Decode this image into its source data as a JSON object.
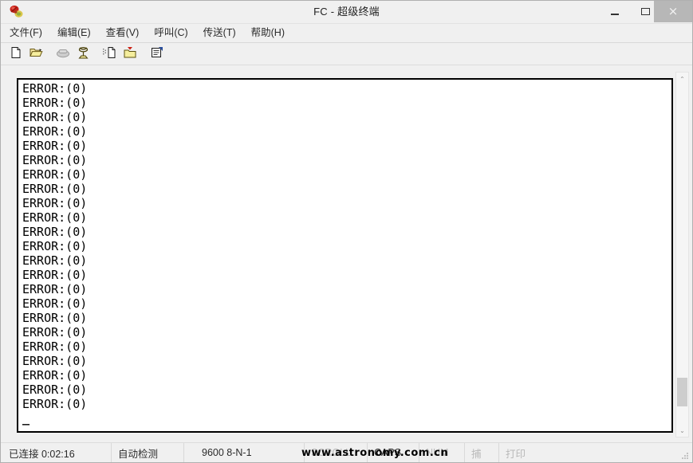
{
  "window": {
    "title": "FC - 超级终端",
    "app_icon": "hyperterminal-icon",
    "controls": {
      "minimize": "–",
      "maximize": "□",
      "close": "×"
    }
  },
  "menubar": {
    "items": [
      {
        "label": "文件(F)",
        "name": "menu-file"
      },
      {
        "label": "编辑(E)",
        "name": "menu-edit"
      },
      {
        "label": "查看(V)",
        "name": "menu-view"
      },
      {
        "label": "呼叫(C)",
        "name": "menu-call"
      },
      {
        "label": "传送(T)",
        "name": "menu-transfer"
      },
      {
        "label": "帮助(H)",
        "name": "menu-help"
      }
    ]
  },
  "toolbar": {
    "buttons": [
      {
        "name": "new-connection-icon",
        "title": "新建连接"
      },
      {
        "name": "open-folder-icon",
        "title": "打开"
      },
      {
        "name": "phone-hangup-icon",
        "title": "挂断"
      },
      {
        "name": "phone-dial-icon",
        "title": "呼叫"
      },
      {
        "name": "send-file-icon",
        "title": "发送"
      },
      {
        "name": "receive-file-icon",
        "title": "接收"
      },
      {
        "name": "properties-icon",
        "title": "属性"
      }
    ]
  },
  "terminal": {
    "lines": [
      "ERROR:(0)",
      "ERROR:(0)",
      "ERROR:(0)",
      "ERROR:(0)",
      "ERROR:(0)",
      "ERROR:(0)",
      "ERROR:(0)",
      "ERROR:(0)",
      "ERROR:(0)",
      "ERROR:(0)",
      "ERROR:(0)",
      "ERROR:(0)",
      "ERROR:(0)",
      "ERROR:(0)",
      "ERROR:(0)",
      "ERROR:(0)",
      "ERROR:(0)",
      "ERROR:(0)",
      "ERROR:(0)",
      "ERROR:(0)",
      "ERROR:(0)",
      "ERROR:(0)",
      "ERROR:(0)"
    ],
    "cursor": "_",
    "background": "#ffffff",
    "foreground": "#000000"
  },
  "scrollbar": {
    "up_arrow": "⌃",
    "down_arrow": "⌄"
  },
  "statusbar": {
    "connected": "已连接 0:02:16",
    "detect": "自动检测",
    "rate": "9600 8-N-1",
    "scroll": "SCROLL",
    "caps": "CAPS",
    "num": "NUM",
    "capture": "捕",
    "print": "打印"
  },
  "watermark": {
    "text": "www.astronomy.com.cn"
  }
}
